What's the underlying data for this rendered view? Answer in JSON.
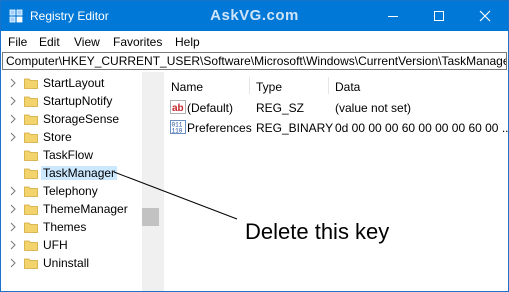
{
  "window": {
    "title": "Registry Editor",
    "watermark": "AskVG.com"
  },
  "menu": {
    "items": [
      "File",
      "Edit",
      "View",
      "Favorites",
      "Help"
    ]
  },
  "address": {
    "path": "Computer\\HKEY_CURRENT_USER\\Software\\Microsoft\\Windows\\CurrentVersion\\TaskManager"
  },
  "tree": {
    "items": [
      {
        "label": "StartLayout"
      },
      {
        "label": "StartupNotify"
      },
      {
        "label": "StorageSense"
      },
      {
        "label": "Store"
      },
      {
        "label": "TaskFlow"
      },
      {
        "label": "TaskManager",
        "selected": true
      },
      {
        "label": "Telephony"
      },
      {
        "label": "ThemeManager"
      },
      {
        "label": "Themes"
      },
      {
        "label": "UFH"
      },
      {
        "label": "Uninstall"
      }
    ]
  },
  "values": {
    "headers": {
      "name": "Name",
      "type": "Type",
      "data": "Data"
    },
    "rows": [
      {
        "name": "(Default)",
        "type": "REG_SZ",
        "data": "(value not set)",
        "icon": "string-value-icon"
      },
      {
        "name": "Preferences",
        "type": "REG_BINARY",
        "data": "0d 00 00 00 60 00 00 00 60 00 ...",
        "icon": "binary-value-icon"
      }
    ]
  },
  "annotation": {
    "text": "Delete this key"
  },
  "colors": {
    "titlebar": "#0078d7",
    "selection": "#cce8ff",
    "folder": "#e8c25a"
  }
}
